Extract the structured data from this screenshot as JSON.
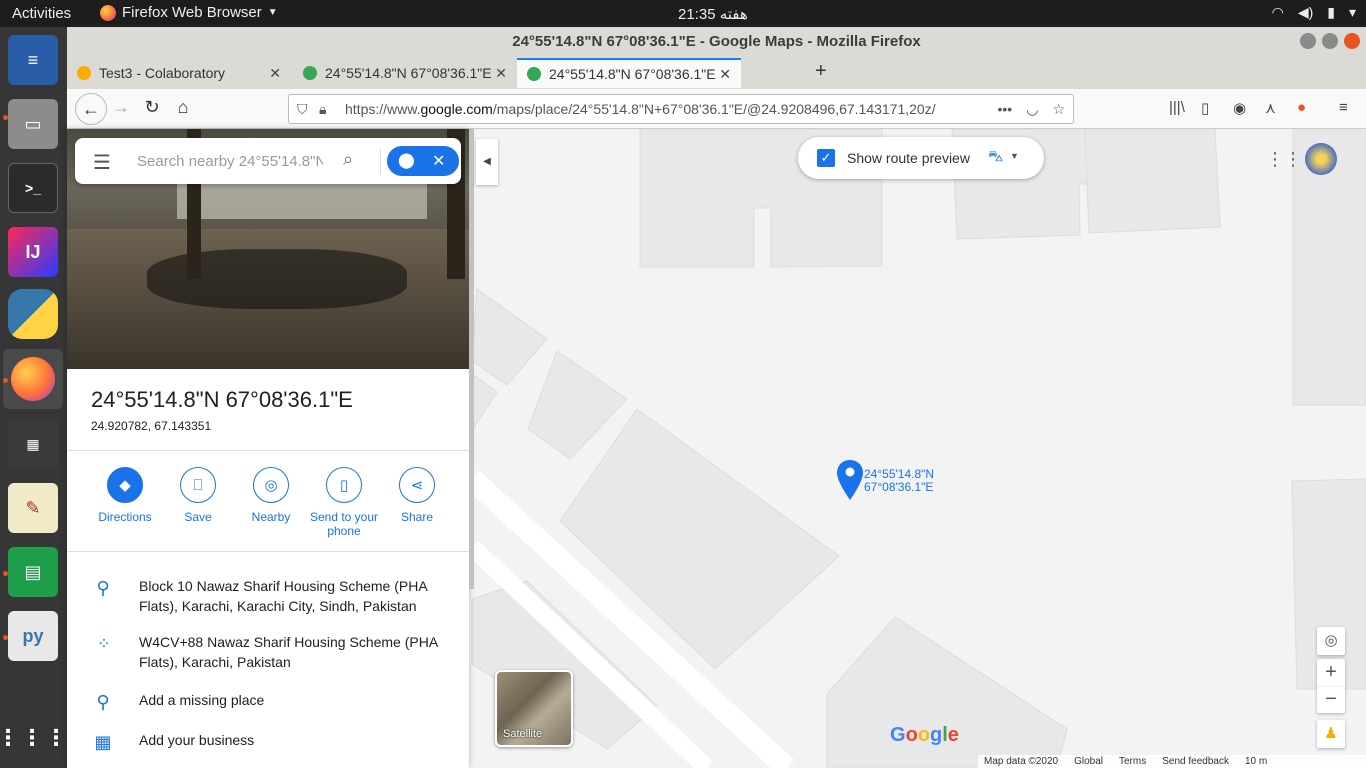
{
  "topbar": {
    "activities": "Activities",
    "app_name": "Firefox Web Browser",
    "clock": "21:35 هفته"
  },
  "window": {
    "title": "24°55'14.8\"N 67°08'36.1\"E - Google Maps - Mozilla Firefox"
  },
  "tabs": [
    {
      "label": "Test3 - Colaboratory"
    },
    {
      "label": "24°55'14.8\"N 67°08'36.1\"E"
    },
    {
      "label": "24°55'14.8\"N 67°08'36.1\"E"
    }
  ],
  "url": {
    "prefix": "https://www.",
    "domain": "google.com",
    "path": "/maps/place/24°55'14.8\"N+67°08'36.1\"E/@24.9208496,67.143171,20z/"
  },
  "search": {
    "placeholder": "Search nearby 24°55'14.8\"N"
  },
  "place": {
    "title": "24°55'14.8\"N 67°08'36.1\"E",
    "coords": "24.920782, 67.143351"
  },
  "actions": [
    {
      "label": "Directions",
      "icon": "directions-icon"
    },
    {
      "label": "Save",
      "icon": "bookmark-icon"
    },
    {
      "label": "Nearby",
      "icon": "nearby-icon"
    },
    {
      "label": "Send to your phone",
      "icon": "phone-icon"
    },
    {
      "label": "Share",
      "icon": "share-icon"
    }
  ],
  "info": {
    "address": "Block 10 Nawaz Sharif Housing Scheme (PHA Flats), Karachi, Karachi City, Sindh, Pakistan",
    "plus_code": "W4CV+88 Nawaz Sharif Housing Scheme (PHA Flats), Karachi, Pakistan",
    "add_place": "Add a missing place",
    "add_business": "Add your business"
  },
  "route_preview": {
    "label": "Show route preview",
    "checked": true
  },
  "marker": {
    "line1": "24°55'14.8\"N",
    "line2": "67°08'36.1\"E"
  },
  "map": {
    "satellite_label": "Satellite",
    "footer": {
      "map_data": "Map data ©2020",
      "global": "Global",
      "terms": "Terms",
      "feedback": "Send feedback",
      "scale": "10 m"
    }
  },
  "colors": {
    "accent": "#1a73e8",
    "ubuntu_orange": "#e95420"
  }
}
